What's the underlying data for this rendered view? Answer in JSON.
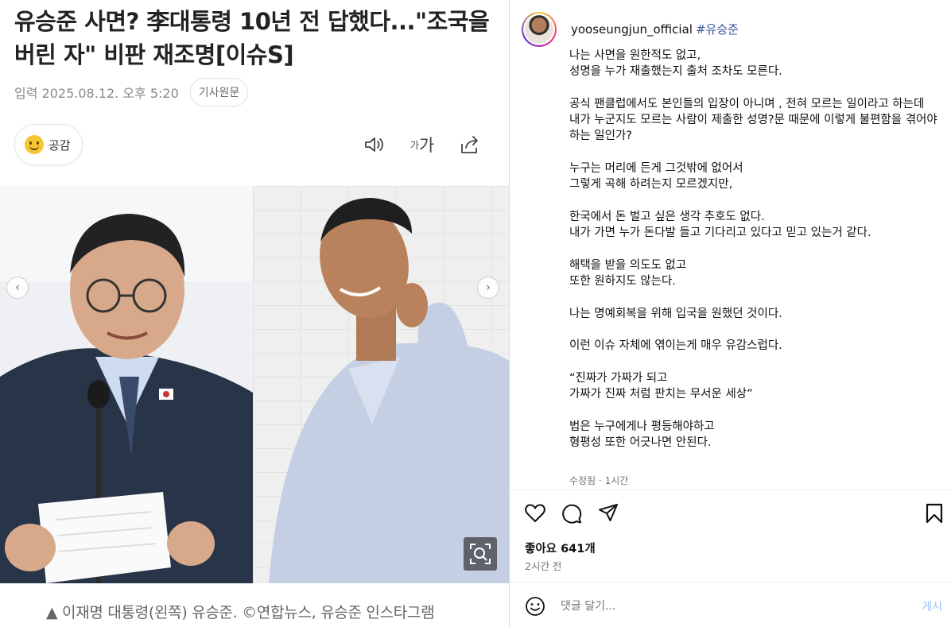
{
  "article": {
    "headline": "유승준 사면? 李대통령 10년 전 답했다...\"조국을 버린 자\" 비판 재조명[이슈S]",
    "date": "입력 2025.08.12. 오후 5:20",
    "original_button": "기사원문",
    "reaction_label": "공감",
    "tools": {
      "audio_icon": "speaker-icon",
      "fontsize_small": "가",
      "fontsize_large": "가",
      "share_icon": "share-icon"
    },
    "photo_caption": "▲ 이재명 대통령(왼쪽) 유승준. ©연합뉴스, 유승준 인스타그램",
    "carousel_prev": "‹",
    "carousel_next": "›"
  },
  "instagram": {
    "username": "yooseungjun_official",
    "hashtag": "#유승준",
    "caption_lines": [
      "나는 사면을 원한적도 없고,",
      "성명을 누가 재출했는지 출처 조차도 모른다.",
      "",
      "공식 팬클럽에서도 본인들의 입장이 아니며 , 전혀 모르는 일이라고 하는데",
      "내가 누군지도 모르는 사람이 제출한 성명?문 때문에 이렇게 불편함을 겪어야 하는 일인가?",
      "",
      "누구는 머리에 든게 그것밖에 없어서",
      "그렇게 곡해 하려는지 모르겠지만,",
      "",
      "한국에서 돈 벌고 싶은 생각 추호도 없다.",
      "내가 가면 누가 돈다발 들고 기다리고 있다고 믿고 있는거 같다.",
      "",
      "해택을 받을 의도도 없고",
      "또한 원하지도 않는다.",
      "",
      "나는 명예회복을 위해 입국을 원했던 것이다.",
      "",
      "이런 이슈 자체에 엮이는게 매우 유감스럽다.",
      "",
      "“진짜가 가짜가 되고",
      "가짜가 진짜 처럼 판치는 무서운 세상”",
      "",
      "법은 누구에게나 평등해야하고",
      "형평성 또한 어긋나면 안된다."
    ],
    "edited_label": "수정됨 · 1시간",
    "likes": "좋아요 641개",
    "time_ago": "2시간 전",
    "comment_placeholder": "댓글 달기...",
    "post_button": "게시"
  },
  "colors": {
    "hashtag": "#3b5998",
    "post_button": "#9cc3f5",
    "muted": "#737373"
  }
}
